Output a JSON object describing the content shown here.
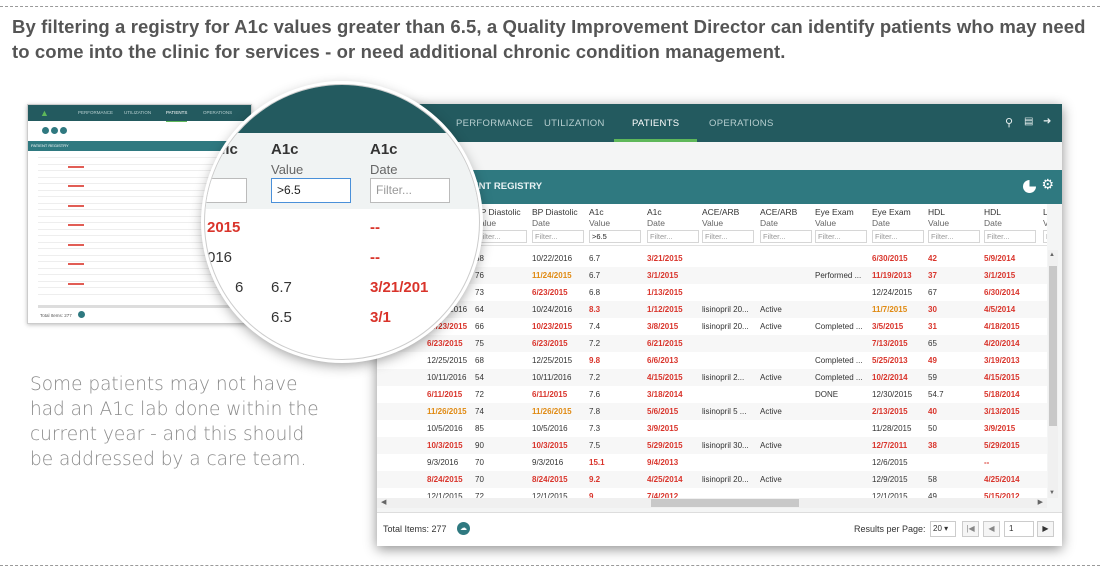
{
  "heading": "By filtering a registry for A1c values greater than 6.5, a Quality Improvement Director can identify patients who may need to come into the clinic for services - or need additional chronic condition management.",
  "note": "Some patients may not have had an A1c lab done within the current year - and this should be addressed by a care team.",
  "nav": {
    "performance": "PERFORMANCE",
    "utilization": "UTILIZATION",
    "patients": "PATIENTS",
    "operations": "OPERATIONS"
  },
  "registry_title": "PATIENT REGISTRY",
  "columns": [
    {
      "title": "BP Diastolic",
      "sub": "Value",
      "filter": "Filter..."
    },
    {
      "title": "BP Diastolic",
      "sub": "Date",
      "filter": "Filter..."
    },
    {
      "title": "A1c",
      "sub": "Value",
      "filter": ">6.5"
    },
    {
      "title": "A1c",
      "sub": "Date",
      "filter": "Filter..."
    },
    {
      "title": "ACE/ARB",
      "sub": "Value",
      "filter": "Filter..."
    },
    {
      "title": "ACE/ARB",
      "sub": "Date",
      "filter": "Filter..."
    },
    {
      "title": "Eye Exam",
      "sub": "Value",
      "filter": "Filter..."
    },
    {
      "title": "Eye Exam",
      "sub": "Date",
      "filter": "Filter..."
    },
    {
      "title": "HDL",
      "sub": "Value",
      "filter": "Filter..."
    },
    {
      "title": "HDL",
      "sub": "Date",
      "filter": "Filter..."
    },
    {
      "title": "LDL",
      "sub": "Valu",
      "filter": "Filter..."
    }
  ],
  "partial_col_title": "lic",
  "rows": [
    {
      "a": "2016",
      "b": "68",
      "c": "10/22/2016",
      "d": "6.7",
      "e": "3/21/2015",
      "f": "",
      "g": "",
      "h": "",
      "i": "6/30/2015",
      "j": "42",
      "k": "5/9/2014"
    },
    {
      "a": "/4/2015",
      "b": "76",
      "c": "11/24/2015",
      "d": "6.7",
      "e": "3/1/2015",
      "f": "",
      "g": "",
      "h": "Performed ...",
      "i": "11/19/2013",
      "j": "37",
      "k": "3/1/2015"
    },
    {
      "a": "6/23/2015",
      "b": "73",
      "c": "6/23/2015",
      "d": "6.8",
      "e": "1/13/2015",
      "f": "",
      "g": "",
      "h": "",
      "i": "12/24/2015",
      "j": "67",
      "k": "6/30/2014"
    },
    {
      "a": "10/24/2016",
      "b": "64",
      "c": "10/24/2016",
      "d": "8.3",
      "e": "1/12/2015",
      "f": "lisinopril 20...",
      "g": "Active",
      "h": "",
      "i": "11/7/2015",
      "j": "30",
      "k": "4/5/2014"
    },
    {
      "a": "10/23/2015",
      "b": "66",
      "c": "10/23/2015",
      "d": "7.4",
      "e": "3/8/2015",
      "f": "lisinopril 20...",
      "g": "Active",
      "h": "Completed ...",
      "i": "3/5/2015",
      "j": "31",
      "k": "4/18/2015"
    },
    {
      "a": "6/23/2015",
      "b": "75",
      "c": "6/23/2015",
      "d": "7.2",
      "e": "6/21/2015",
      "f": "",
      "g": "",
      "h": "",
      "i": "7/13/2015",
      "j": "65",
      "k": "4/20/2014"
    },
    {
      "a": "12/25/2015",
      "b": "68",
      "c": "12/25/2015",
      "d": "9.8",
      "e": "6/6/2013",
      "f": "",
      "g": "",
      "h": "Completed ...",
      "i": "5/25/2013",
      "j": "49",
      "k": "3/19/2013"
    },
    {
      "a": "10/11/2016",
      "b": "54",
      "c": "10/11/2016",
      "d": "7.2",
      "e": "4/15/2015",
      "f": "lisinopril 2...",
      "g": "Active",
      "h": "Completed ...",
      "i": "10/2/2014",
      "j": "59",
      "k": "4/15/2015"
    },
    {
      "a": "6/11/2015",
      "b": "72",
      "c": "6/11/2015",
      "d": "7.6",
      "e": "3/18/2014",
      "f": "",
      "g": "",
      "h": "DONE",
      "i": "12/30/2015",
      "j": "54.7",
      "k": "5/18/2014"
    },
    {
      "a": "11/26/2015",
      "b": "74",
      "c": "11/26/2015",
      "d": "7.8",
      "e": "5/6/2015",
      "f": "lisinopril 5 ...",
      "g": "Active",
      "h": "",
      "i": "2/13/2015",
      "j": "40",
      "k": "3/13/2015"
    },
    {
      "a": "10/5/2016",
      "b": "85",
      "c": "10/5/2016",
      "d": "7.3",
      "e": "3/9/2015",
      "f": "",
      "g": "",
      "h": "",
      "i": "11/28/2015",
      "j": "50",
      "k": "3/9/2015"
    },
    {
      "a": "10/3/2015",
      "b": "90",
      "c": "10/3/2015",
      "d": "7.5",
      "e": "5/29/2015",
      "f": "lisinopril 30...",
      "g": "Active",
      "h": "",
      "i": "12/7/2011",
      "j": "38",
      "k": "5/29/2015"
    },
    {
      "a": "9/3/2016",
      "b": "70",
      "c": "9/3/2016",
      "d": "15.1",
      "e": "9/4/2013",
      "f": "",
      "g": "",
      "h": "",
      "i": "12/6/2015",
      "j": "",
      "k": "--"
    },
    {
      "a": "8/24/2015",
      "b": "70",
      "c": "8/24/2015",
      "d": "9.2",
      "e": "4/25/2014",
      "f": "lisinopril 20...",
      "g": "Active",
      "h": "",
      "i": "12/9/2015",
      "j": "58",
      "k": "4/25/2014"
    },
    {
      "a": "12/1/2015",
      "b": "72",
      "c": "12/1/2015",
      "d": "9",
      "e": "7/4/2012",
      "f": "",
      "g": "",
      "h": "",
      "i": "12/1/2015",
      "j": "49",
      "k": "5/15/2012"
    }
  ],
  "footer": {
    "total": "Total Items: 277",
    "rpp": "Results per Page:",
    "rpp_value": "20",
    "page": "1"
  },
  "magnifier": {
    "col1": "tolic",
    "col2_title": "A1c",
    "col2_sub": "Value",
    "col2_filter": ">6.5",
    "col3_title": "A1c",
    "col3_sub": "Date",
    "col3_filter": "Filter...",
    "r1a": "2015",
    "r1c": "--",
    "r2a": "016",
    "r2c": "--",
    "r3a": "6",
    "r3b": "6.7",
    "r3c": "3/21/201",
    "r4b": "6.5",
    "r4c": "3/1"
  },
  "thumb": {
    "nav1": "PERFORMANCE",
    "nav2": "UTILIZATION",
    "nav3": "PATIENTS",
    "nav4": "OPERATIONS",
    "bar": "PATIENT REGISTRY",
    "total": "Total Items: 277"
  }
}
